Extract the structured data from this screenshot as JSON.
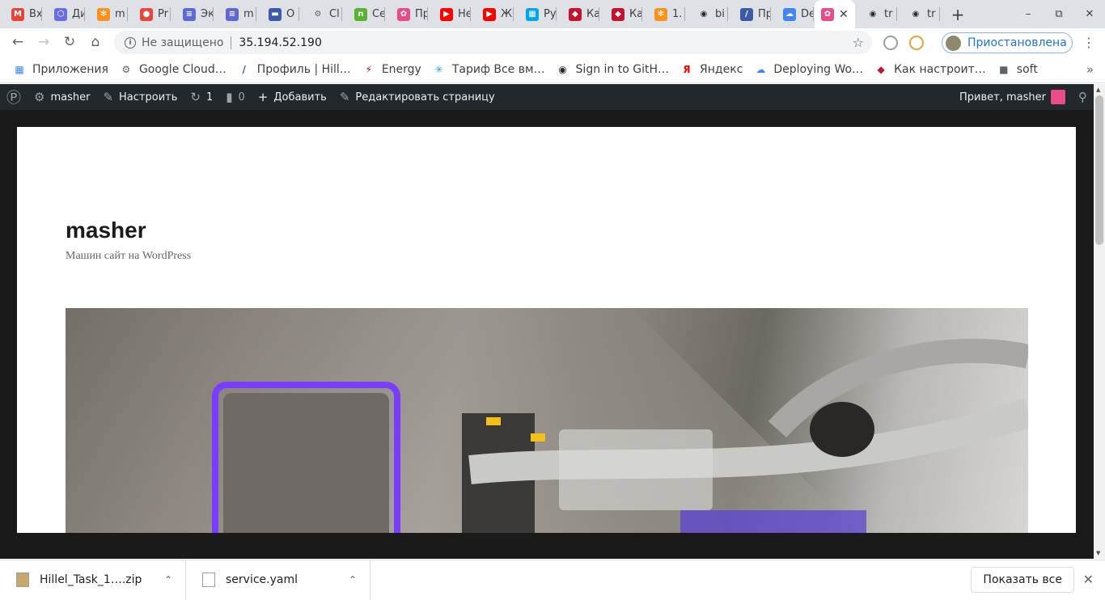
{
  "colors": {
    "tabstrip": "#dee1e6",
    "wpbar": "#23282d",
    "accent": "#1a73e8"
  },
  "tabs": [
    {
      "label": "Вх",
      "icon": "gmail-icon",
      "color": "#ea4335"
    },
    {
      "label": "Ди",
      "icon": "hexagon-icon",
      "color": "#6a6ee0"
    },
    {
      "label": "m",
      "icon": "grafana-icon",
      "color": "#f7931e"
    },
    {
      "label": "Pr",
      "icon": "mic-icon",
      "color": "#e8453c"
    },
    {
      "label": "Эк",
      "icon": "layers-icon",
      "color": "#5e6ad2"
    },
    {
      "label": "m",
      "icon": "layers-icon",
      "color": "#5e6ad2"
    },
    {
      "label": "О",
      "icon": "card-icon",
      "color": "#3b5ba9"
    },
    {
      "label": "Cl",
      "icon": "gear-icon",
      "color": "#5f6368"
    },
    {
      "label": "Се",
      "icon": "n-icon",
      "color": "#5bb332"
    },
    {
      "label": "Пр",
      "icon": "flower-icon",
      "color": "#e84d8a"
    },
    {
      "label": "Не",
      "icon": "youtube-icon",
      "color": "#ff0000"
    },
    {
      "label": "Ж",
      "icon": "youtube-icon",
      "color": "#ff0000"
    },
    {
      "label": "Ру",
      "icon": "windows-icon",
      "color": "#00a4ef"
    },
    {
      "label": "Ка",
      "icon": "ruby-icon",
      "color": "#c4122f"
    },
    {
      "label": "Ка",
      "icon": "ruby-icon",
      "color": "#c4122f"
    },
    {
      "label": "1.",
      "icon": "grafana-icon",
      "color": "#f7931e"
    },
    {
      "label": "bi",
      "icon": "github-icon",
      "color": "#24292e"
    },
    {
      "label": "Пр",
      "icon": "slash-icon",
      "color": "#3b5ba9"
    },
    {
      "label": "De",
      "icon": "gcloud-icon",
      "color": "#4285f4"
    },
    {
      "label": "",
      "icon": "flower-icon",
      "color": "#e84d8a",
      "active": true
    },
    {
      "label": "tr",
      "icon": "github-icon",
      "color": "#24292e"
    },
    {
      "label": "tr",
      "icon": "github-icon",
      "color": "#24292e"
    }
  ],
  "omnibox": {
    "security": "Не защищено",
    "url": "35.194.52.190"
  },
  "profile": {
    "status": "Приостановлена"
  },
  "bookmarks": [
    {
      "label": "Приложения",
      "icon": "apps-grid-icon"
    },
    {
      "label": "Google Cloud…",
      "icon": "gear-icon"
    },
    {
      "label": "Профиль | Hill…",
      "icon": "slash-icon"
    },
    {
      "label": "Energy",
      "icon": "energy-icon"
    },
    {
      "label": "Тариф Все вм…",
      "icon": "kyivstar-icon"
    },
    {
      "label": "Sign in to GitH…",
      "icon": "github-icon"
    },
    {
      "label": "Яндекс",
      "icon": "yandex-icon"
    },
    {
      "label": "Deploying Wo…",
      "icon": "gcloud-icon"
    },
    {
      "label": "Как настроит…",
      "icon": "ruby-icon"
    },
    {
      "label": "soft",
      "icon": "folder-icon"
    }
  ],
  "wpbar": {
    "site": "masher",
    "customize": "Настроить",
    "updates": "1",
    "comments": "0",
    "new": "Добавить",
    "edit": "Редактировать страницу",
    "howdy": "Привет, masher"
  },
  "site": {
    "title": "masher",
    "description": "Машин сайт на WordPress"
  },
  "downloads": {
    "items": [
      {
        "name": "Hillel_Task_1….zip",
        "icon": "zip-file-icon"
      },
      {
        "name": "service.yaml",
        "icon": "file-icon"
      }
    ],
    "show_all": "Показать все"
  }
}
